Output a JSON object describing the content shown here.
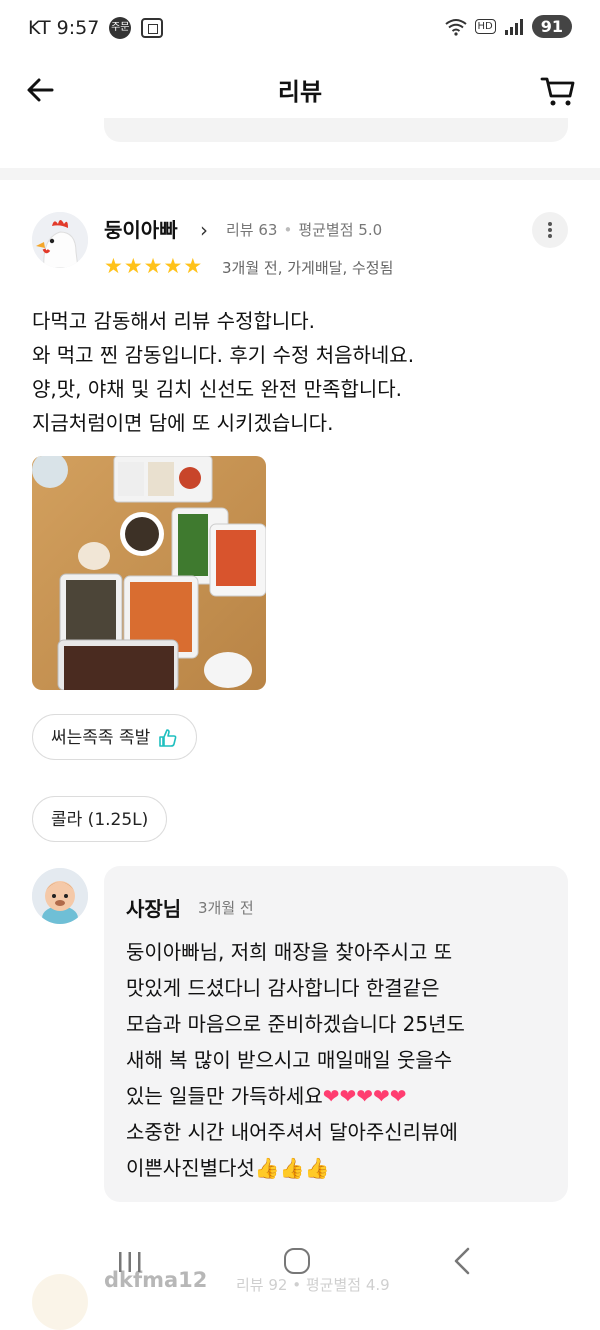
{
  "status_bar": {
    "carrier_time": "KT 9:57",
    "chip": "주문",
    "hd": "HD",
    "battery": "91"
  },
  "header": {
    "title": "리뷰",
    "back_icon": "arrow-left-icon",
    "cart_icon": "cart-icon"
  },
  "review": {
    "reviewer_name": "둥이아빠",
    "review_count": "리뷰 63",
    "avg_rating": "평균별점 5.0",
    "rating": 5,
    "meta": "3개월 전, 가게배달, 수정됨",
    "text_lines": [
      "다먹고 감동해서 리뷰 수정합니다.",
      "와 먹고 찐 감동입니다. 후기 수정 처음하네요.",
      "양,맛, 야채 및 김치 신선도 완전 만족합니다.",
      "지금처럼이면 담에 또 시키겠습니다."
    ],
    "menu_tags": [
      "써는족족 족발",
      "콜라 (1.25L)"
    ]
  },
  "owner_reply": {
    "name": "사장님",
    "time": "3개월 전",
    "lines": [
      "둥이아빠님, 저희 매장을 찾아주시고 또",
      "맛있게 드셨다니 감사합니다 한결같은",
      "모습과 마음으로 준비하겠습니다 25년도",
      "새해 복 많이 받으시고 매일매일 웃을수",
      "있는 일들만 가득하세요",
      "소중한 시간 내어주셔서 달아주신리뷰에",
      "이쁜사진별다섯"
    ],
    "hearts": "❤❤❤❤❤",
    "thumbs": "👍👍👍"
  },
  "next_review": {
    "name": "dkfma12",
    "review_count": "리뷰 92",
    "avg_rating": "평균별점 4.9"
  },
  "colors": {
    "star": "#ffc21a",
    "heart": "#ff3d70",
    "bubble": "#f4f4f5"
  }
}
